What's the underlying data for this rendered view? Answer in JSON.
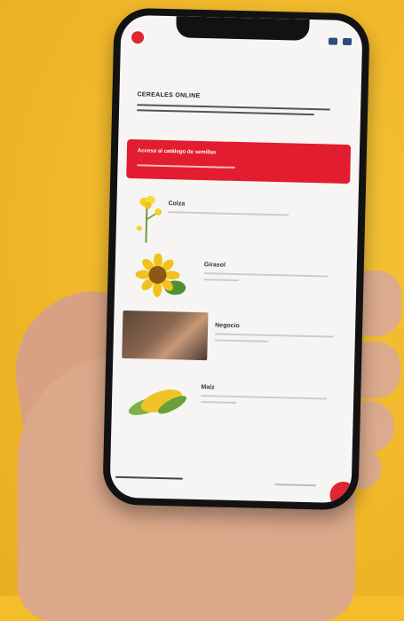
{
  "screen": {
    "heading": "CEREALES ONLINE",
    "banner_title": "Acceso al catálogo de semillas",
    "items": [
      {
        "title": "Colza"
      },
      {
        "title": "Girasol"
      },
      {
        "title": "Negocio"
      },
      {
        "title": "Maíz"
      }
    ]
  },
  "colors": {
    "background": "#f4bd2c",
    "accent": "#e21d2f"
  }
}
